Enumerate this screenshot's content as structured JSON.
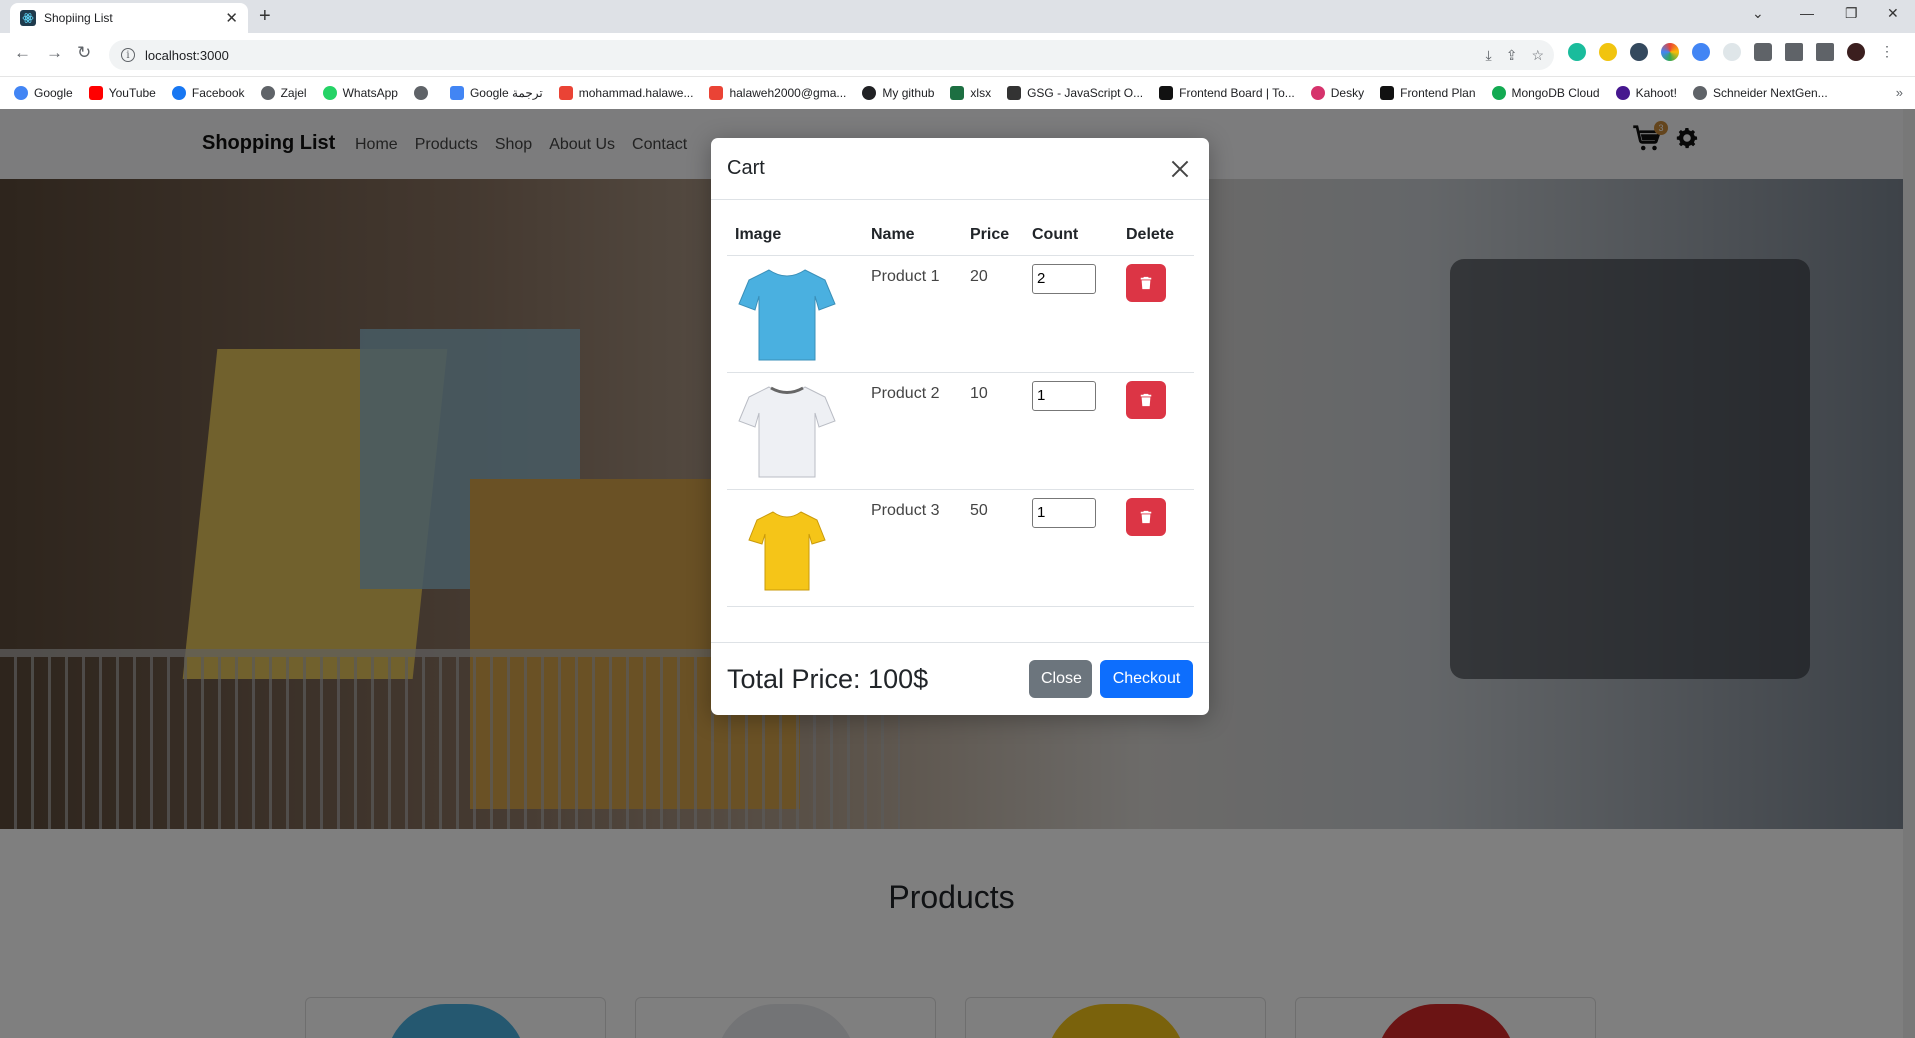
{
  "browser": {
    "tab_title": "Shopiing List",
    "url": "localhost:3000",
    "bookmarks": [
      {
        "label": "Google",
        "color": "#4285f4"
      },
      {
        "label": "YouTube",
        "color": "#ff0000"
      },
      {
        "label": "Facebook",
        "color": "#1877f2"
      },
      {
        "label": "Zajel",
        "color": "#5f6368"
      },
      {
        "label": "WhatsApp",
        "color": "#25d366"
      },
      {
        "label": "",
        "color": "#5f6368"
      },
      {
        "label": "Google ترجمة",
        "color": "#4285f4"
      },
      {
        "label": "mohammad.halawe...",
        "color": "#ea4335"
      },
      {
        "label": "halaweh2000@gma...",
        "color": "#ea4335"
      },
      {
        "label": "My github",
        "color": "#202124"
      },
      {
        "label": "xlsx",
        "color": "#1d6f42"
      },
      {
        "label": "GSG - JavaScript O...",
        "color": "#333333"
      },
      {
        "label": "Frontend Board | To...",
        "color": "#111111"
      },
      {
        "label": "Desky",
        "color": "#d6336c"
      },
      {
        "label": "Frontend Plan",
        "color": "#111111"
      },
      {
        "label": "MongoDB Cloud",
        "color": "#13aa52"
      },
      {
        "label": "Kahoot!",
        "color": "#46178f"
      },
      {
        "label": "Schneider NextGen...",
        "color": "#5f6368"
      }
    ]
  },
  "site": {
    "brand": "Shopping List",
    "nav": [
      "Home",
      "Products",
      "Shop",
      "About Us",
      "Contact"
    ],
    "cart_badge": "3",
    "products_heading": "Products"
  },
  "cart": {
    "title": "Cart",
    "columns": [
      "Image",
      "Name",
      "Price",
      "Count",
      "Delete"
    ],
    "items": [
      {
        "name": "Product 1",
        "price": "20",
        "count": "2",
        "color": "#4ab0e0"
      },
      {
        "name": "Product 2",
        "price": "10",
        "count": "1",
        "color": "#eef0f4"
      },
      {
        "name": "Product 3",
        "price": "50",
        "count": "1",
        "color": "#f5c518"
      }
    ],
    "total_label": "Total Price: 100$",
    "close_label": "Close",
    "checkout_label": "Checkout"
  },
  "colors": {
    "danger": "#dc3545",
    "primary": "#0d6efd",
    "secondary": "#6c757d"
  }
}
